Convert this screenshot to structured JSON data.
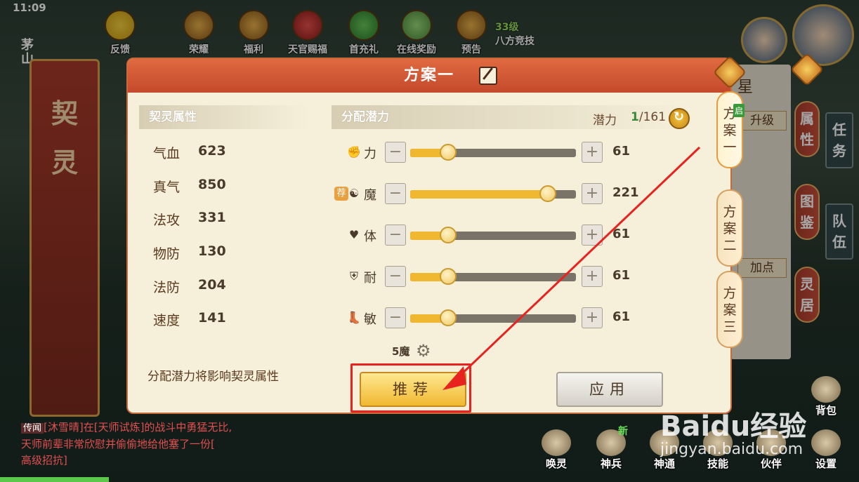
{
  "status": {
    "clock": "11:09"
  },
  "topbar": {
    "items": [
      {
        "label": "反馈"
      },
      {
        "label": "荣耀"
      },
      {
        "label": "福利"
      },
      {
        "label": "天官赐福"
      },
      {
        "label": "首充礼"
      },
      {
        "label": "在线奖励"
      },
      {
        "label": "预告"
      }
    ],
    "level": {
      "num": "33级",
      "label": "八方竞技"
    },
    "left_fragment": "茅山"
  },
  "left_panel": {
    "title": "契灵"
  },
  "dialog": {
    "title": "方案一",
    "attr_header": "契灵属性",
    "attrs": [
      {
        "name": "气血",
        "value": "623"
      },
      {
        "name": "真气",
        "value": "850"
      },
      {
        "name": "法攻",
        "value": "331"
      },
      {
        "name": "物防",
        "value": "130"
      },
      {
        "name": "法防",
        "value": "204"
      },
      {
        "name": "速度",
        "value": "141"
      }
    ],
    "note": "分配潜力将影响契灵属性",
    "potential_header": "分配潜力",
    "potential_label": "潜力",
    "potential_current": "1",
    "potential_total": "/161",
    "sliders": [
      {
        "name": "力",
        "icon": "fist-icon",
        "value": "61",
        "level": 0.23,
        "recommended": false
      },
      {
        "name": "魔",
        "icon": "yin-yang-icon",
        "value": "221",
        "level": 0.83,
        "recommended": true,
        "rec_tag": "荐"
      },
      {
        "name": "体",
        "icon": "heart-icon",
        "value": "61",
        "level": 0.23,
        "recommended": false
      },
      {
        "name": "耐",
        "icon": "shield-icon",
        "value": "61",
        "level": 0.23,
        "recommended": false
      },
      {
        "name": "敏",
        "icon": "boot-icon",
        "value": "61",
        "level": 0.23,
        "recommended": false
      }
    ],
    "preset_label": "5魔",
    "recommend_button": "推荐",
    "apply_button": "应用"
  },
  "tabs": [
    {
      "label": "方案一",
      "badge": "启"
    },
    {
      "label": "方案二"
    },
    {
      "label": "方案三"
    }
  ],
  "background_panel": {
    "star": "星",
    "upgrade": "升级",
    "add_points": "加点"
  },
  "right_menu": [
    {
      "label": "属性"
    },
    {
      "label": "图鉴"
    },
    {
      "label": "灵居"
    },
    {
      "label": "任务"
    },
    {
      "label": "队伍"
    }
  ],
  "chat": {
    "tag": "传闻",
    "line1": "[沐雪晴]在[天师试炼]的战斗中勇猛无比,",
    "line2": "天师前辈非常欣慰并偷偷地给他塞了一份[",
    "line3": "高级招抗]"
  },
  "bottombar": {
    "items": [
      {
        "label": "唤灵"
      },
      {
        "label": "神兵",
        "badge": "新"
      },
      {
        "label": "神通"
      },
      {
        "label": "技能"
      },
      {
        "label": "伙伴"
      },
      {
        "label": "设置"
      }
    ],
    "bag": "背包"
  },
  "watermark": {
    "logo": "Baidu经验",
    "url": "jingyan.baidu.com"
  },
  "colors": {
    "accent": "#e06a40",
    "highlight": "#e8231f",
    "fill": "#f0b830"
  }
}
